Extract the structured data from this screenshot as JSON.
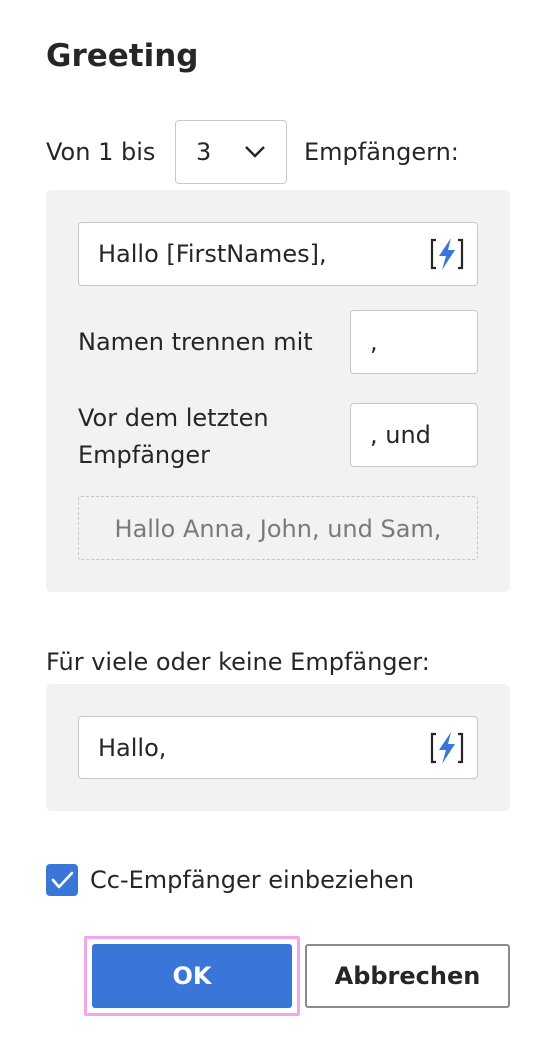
{
  "dialog": {
    "title": "Greeting"
  },
  "range": {
    "prefix": "Von 1 bis",
    "selected": "3",
    "suffix": "Empfängern:"
  },
  "few_recipients": {
    "greeting_value": "Hallo [FirstNames],",
    "separator_label": "Namen trennen mit",
    "separator_value": ",",
    "last_label_line1": "Vor dem letzten",
    "last_label_line2": "Empfänger",
    "last_value": ", und",
    "preview": "Hallo Anna, John, und Sam,"
  },
  "many_recipients": {
    "label": "Für viele oder keine Empfänger:",
    "greeting_value": "Hallo,"
  },
  "cc_option": {
    "label": "Cc-Empfänger einbeziehen",
    "checked": true
  },
  "buttons": {
    "ok": "OK",
    "cancel": "Abbrechen"
  },
  "colors": {
    "accent": "#3a76d8",
    "focus": "#f2a6ee",
    "panel": "#f2f2f2"
  },
  "icons": {
    "bolt": "lightning-bolt-icon",
    "chevron": "chevron-down-icon",
    "check": "checkmark-icon"
  }
}
